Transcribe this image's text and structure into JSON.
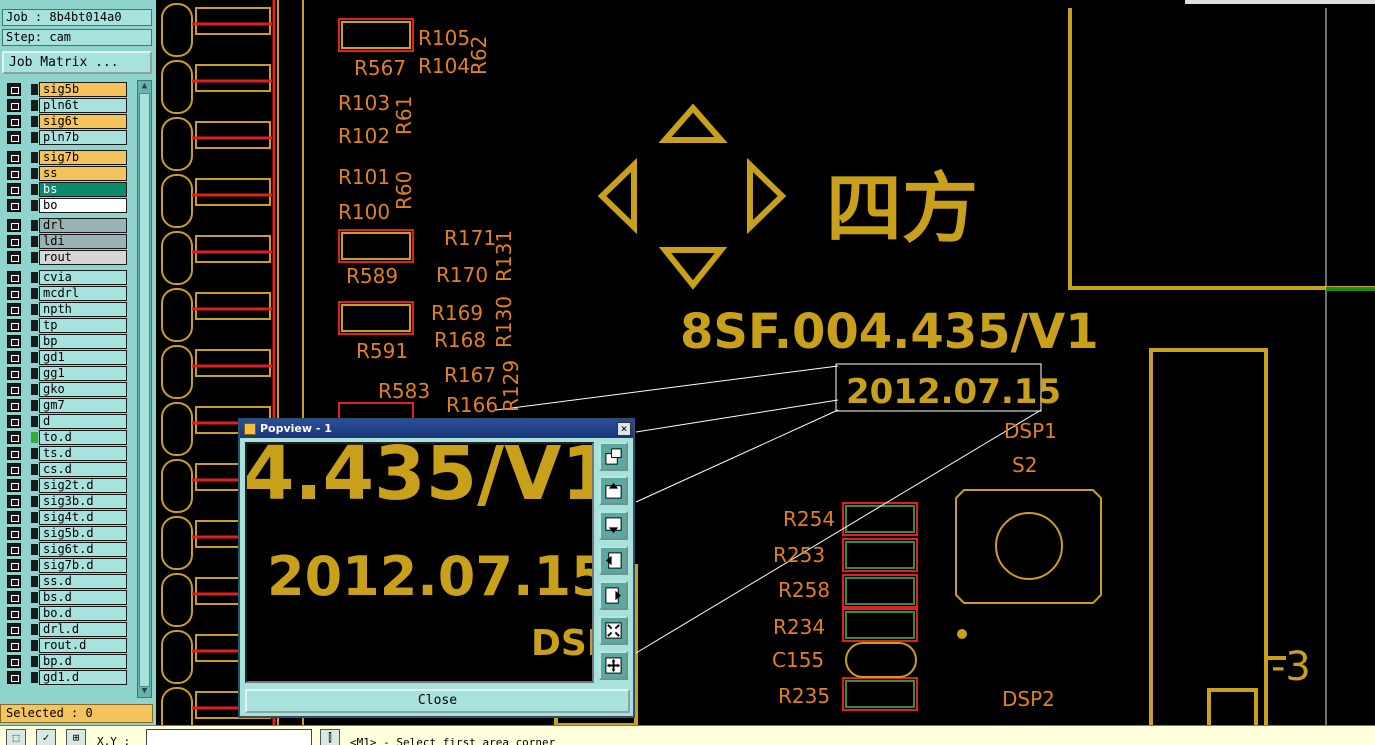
{
  "panel": {
    "job": "Job : 8b4bt014a0",
    "step": "Step: cam",
    "job_matrix_button": "Job Matrix ...",
    "selected": "Selected : 0"
  },
  "layers": [
    {
      "name": "sig5b",
      "color": "#f5c35c"
    },
    {
      "name": "pln6t",
      "color": "#a7e3dc"
    },
    {
      "name": "sig6t",
      "color": "#f5c35c"
    },
    {
      "name": "pln7b",
      "color": "#a7e3dc"
    },
    {
      "name": "sig7b",
      "color": "#f5c35c"
    },
    {
      "name": "ss",
      "color": "#f5c35c"
    },
    {
      "name": "bs",
      "color": "#0d8a6c"
    },
    {
      "name": "bo",
      "color": "#ffffff"
    },
    {
      "name": "drl",
      "color": "#9ab2b4"
    },
    {
      "name": "ldi",
      "color": "#9ab2b4"
    },
    {
      "name": "rout",
      "color": "#d6d6d6"
    },
    {
      "name": "cvia",
      "color": "#a7e3dc"
    },
    {
      "name": "mcdrl",
      "color": "#a7e3dc"
    },
    {
      "name": "npth",
      "color": "#a7e3dc"
    },
    {
      "name": "tp",
      "color": "#a7e3dc"
    },
    {
      "name": "bp",
      "color": "#a7e3dc"
    },
    {
      "name": "gd1",
      "color": "#a7e3dc"
    },
    {
      "name": "gg1",
      "color": "#a7e3dc"
    },
    {
      "name": "gko",
      "color": "#a7e3dc"
    },
    {
      "name": "gm7",
      "color": "#a7e3dc"
    },
    {
      "name": "d",
      "color": "#a7e3dc"
    },
    {
      "name": "to.d",
      "color": "#a7e3dc"
    },
    {
      "name": "ts.d",
      "color": "#a7e3dc"
    },
    {
      "name": "cs.d",
      "color": "#a7e3dc"
    },
    {
      "name": "sig2t.d",
      "color": "#a7e3dc"
    },
    {
      "name": "sig3b.d",
      "color": "#a7e3dc"
    },
    {
      "name": "sig4t.d",
      "color": "#a7e3dc"
    },
    {
      "name": "sig5b.d",
      "color": "#a7e3dc"
    },
    {
      "name": "sig6t.d",
      "color": "#a7e3dc"
    },
    {
      "name": "sig7b.d",
      "color": "#a7e3dc"
    },
    {
      "name": "ss.d",
      "color": "#a7e3dc"
    },
    {
      "name": "bs.d",
      "color": "#a7e3dc"
    },
    {
      "name": "bo.d",
      "color": "#a7e3dc"
    },
    {
      "name": "drl.d",
      "color": "#a7e3dc"
    },
    {
      "name": "rout.d",
      "color": "#a7e3dc"
    },
    {
      "name": "bp.d",
      "color": "#a7e3dc"
    },
    {
      "name": "gd1.d",
      "color": "#a7e3dc"
    }
  ],
  "canvas": {
    "silkscreen_color": "#c8a01a",
    "pad_outline_color": "#e02020",
    "refdes_color": "#e0801e",
    "board_text_part": "8SF.004.435/V1",
    "board_text_date": "2012.07.15",
    "board_text_chinese": "四方",
    "component_labels": [
      "R105",
      "R567",
      "R104",
      "R62",
      "R103",
      "R61",
      "R102",
      "R101",
      "R60",
      "R100",
      "R171",
      "R131",
      "R589",
      "R170",
      "R169",
      "R130",
      "R591",
      "R168",
      "R167",
      "R129",
      "R583",
      "R166",
      "DSP1",
      "S2",
      "R254",
      "R253",
      "R258",
      "R234",
      "C155",
      "R235",
      "DSP2",
      "-3"
    ]
  },
  "popview": {
    "title": "Popview - 1",
    "close_x": "×",
    "view_text_part": "4.435/V1",
    "view_text_date": "2012.07.15",
    "view_text_dsp": "DSP",
    "close_button": "Close"
  },
  "statusbar": {
    "xy_label": "X,Y :",
    "xy_value": "",
    "message": "<M1> - Select first area corner"
  }
}
